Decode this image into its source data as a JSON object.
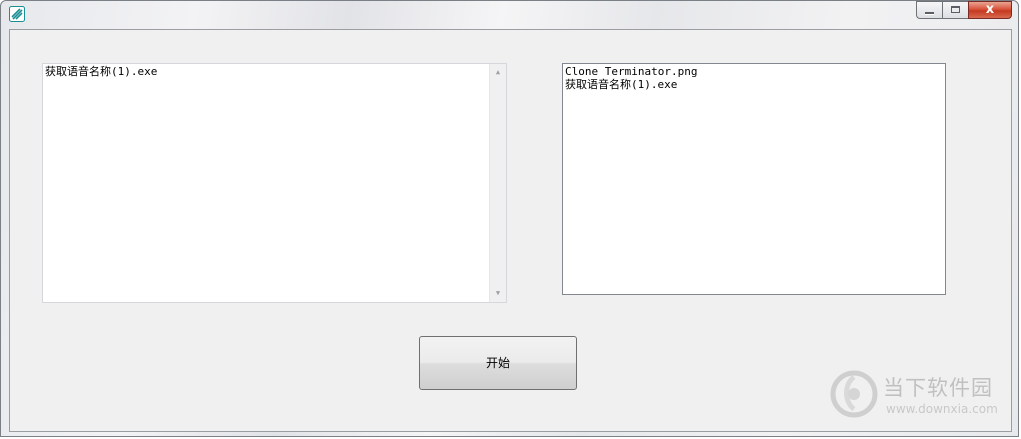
{
  "window": {
    "title": "",
    "close_glyph": "x"
  },
  "left_list": {
    "items": [
      "获取语音名称(1).exe"
    ]
  },
  "right_list": {
    "items": [
      "Clone Terminator.png",
      "获取语音名称(1).exe"
    ]
  },
  "start_button": {
    "label": "开始"
  },
  "watermark": {
    "name": "当下软件园",
    "url": "www.downxia.com"
  },
  "icons": {
    "app": "app-icon",
    "minimize": "minimize-icon",
    "maximize": "maximize-icon",
    "close": "close-icon",
    "scroll_up": "scroll-up-arrow-icon",
    "scroll_down": "scroll-down-arrow-icon"
  }
}
